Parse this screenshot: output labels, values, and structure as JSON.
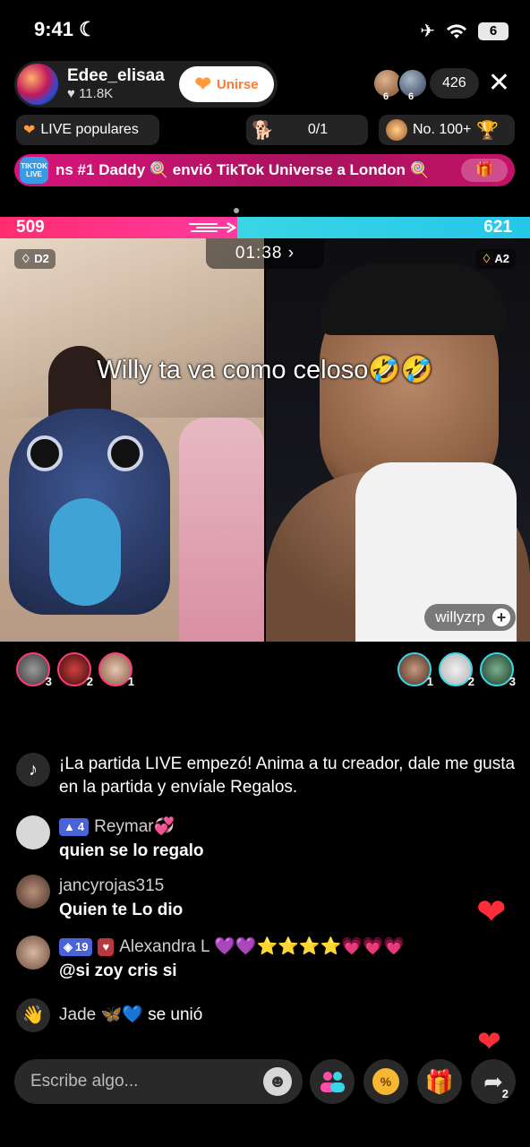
{
  "status_bar": {
    "time": "9:41",
    "battery": "6"
  },
  "host": {
    "name": "Edee_elisaa",
    "likes": "11.8K",
    "join_label": "Unirse"
  },
  "viewers": {
    "count": "426",
    "badges": [
      "6",
      "6"
    ]
  },
  "ranking": {
    "live_label": "LIVE populares",
    "score": "0/1",
    "rank": "No. 100+"
  },
  "gift_banner": {
    "logo_text": "TIKTOK LIVE",
    "text": "ns #1 Daddy 🍭 envió TikTok Universe a London 🍭"
  },
  "battle": {
    "left_score": "509",
    "right_score": "621",
    "timer": "01:38 ›",
    "left_tag": "D2",
    "right_tag": "A2",
    "opponent": "willyzrp"
  },
  "caption": "Willy ta va como celoso🤣🤣",
  "supporters": {
    "left": [
      "3",
      "2",
      "1"
    ],
    "right": [
      "1",
      "2",
      "3"
    ]
  },
  "chat": {
    "system": "¡La partida LIVE empezó! Anima a tu creador, dale me gusta en la partida y envíale Regalos.",
    "messages": [
      {
        "user": "Reymar💞",
        "level": "4",
        "text": "quien se lo regalo"
      },
      {
        "user": "jancyrojas315",
        "text": "Quien te Lo dio"
      },
      {
        "user": "Alexandra L 💜💜⭐⭐⭐⭐💗💗💗",
        "level": "19",
        "text": "@si zoy cris si"
      }
    ],
    "join": {
      "user": "Jade 🦋💙",
      "text": "se unió"
    }
  },
  "input": {
    "placeholder": "Escribe algo..."
  },
  "share_count": "2",
  "colors": {
    "left_team": "#ff2d6f",
    "right_team": "#3ad6e6",
    "join_orange": "#ff7a2e"
  }
}
